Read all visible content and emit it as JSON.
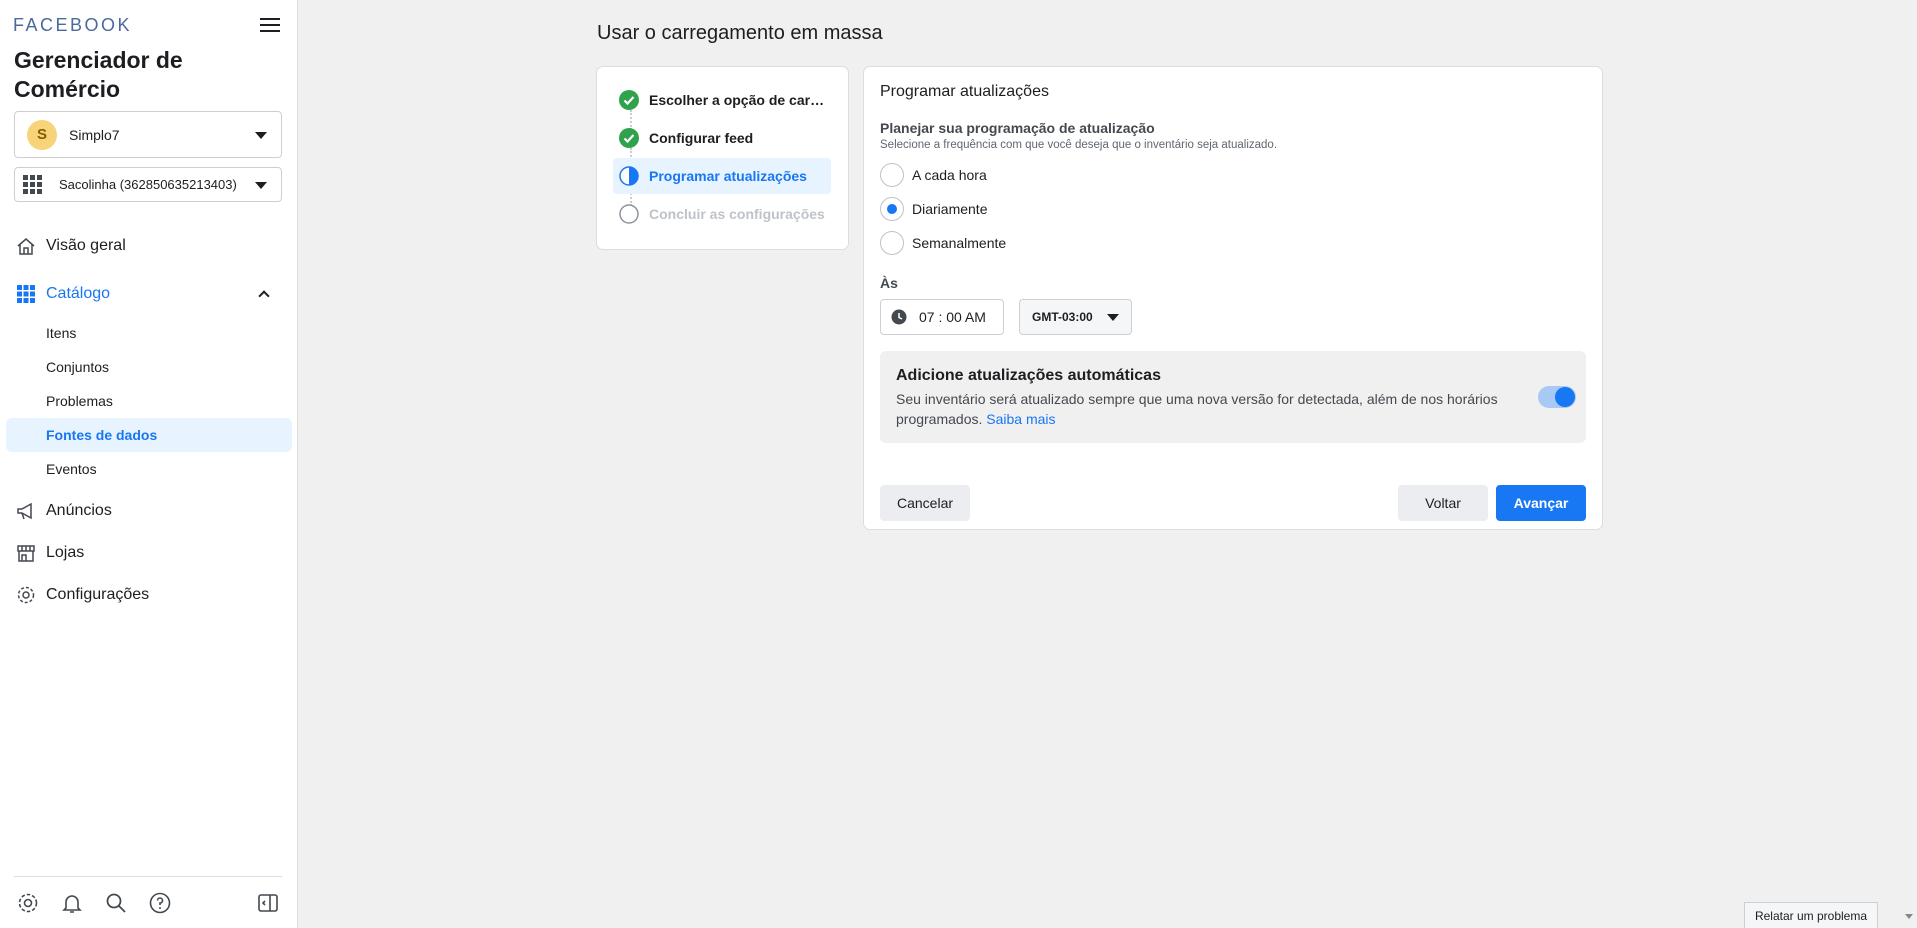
{
  "sidebar": {
    "brand": "FACEBOOK",
    "app_title": "Gerenciador de Comércio",
    "business": {
      "initial": "S",
      "name": "Simplo7"
    },
    "catalog": {
      "name": "Sacolinha (362850635213403)"
    },
    "nav": {
      "overview": "Visão geral",
      "catalog": "Catálogo",
      "catalog_sub": [
        "Itens",
        "Conjuntos",
        "Problemas",
        "Fontes de dados",
        "Eventos"
      ],
      "ads": "Anúncios",
      "shops": "Lojas",
      "settings": "Configurações"
    },
    "footer_icons": [
      "gear-icon",
      "bell-icon",
      "search-icon",
      "help-icon",
      "panel-icon"
    ]
  },
  "main": {
    "page_title": "Usar o carregamento em massa",
    "steps": [
      {
        "label": "Escolher a opção de carregamento",
        "state": "done"
      },
      {
        "label": "Configurar feed",
        "state": "done"
      },
      {
        "label": "Programar atualizações",
        "state": "current"
      },
      {
        "label": "Concluir as configurações",
        "state": "pending"
      }
    ],
    "form": {
      "title": "Programar atualizações",
      "schedule_label": "Planejar sua programação de atualização",
      "schedule_desc": "Selecione a frequência com que você deseja que o inventário seja atualizado.",
      "options": [
        "A cada hora",
        "Diariamente",
        "Semanalmente"
      ],
      "selected_option": "Diariamente",
      "at_label": "Às",
      "time_value": "07 : 00 AM",
      "timezone": "GMT-03:00",
      "auto_title": "Adicione atualizações automáticas",
      "auto_desc": "Seu inventário será atualizado sempre que uma nova versão for detectada, além de nos horários programados.",
      "auto_link": "Saiba mais",
      "auto_enabled": true,
      "cancel_label": "Cancelar",
      "back_label": "Voltar",
      "next_label": "Avançar"
    }
  },
  "report_label": "Relatar um problema",
  "colors": {
    "accent": "#1877f2",
    "success": "#31a24c",
    "selected_bg": "#e7f3ff"
  }
}
